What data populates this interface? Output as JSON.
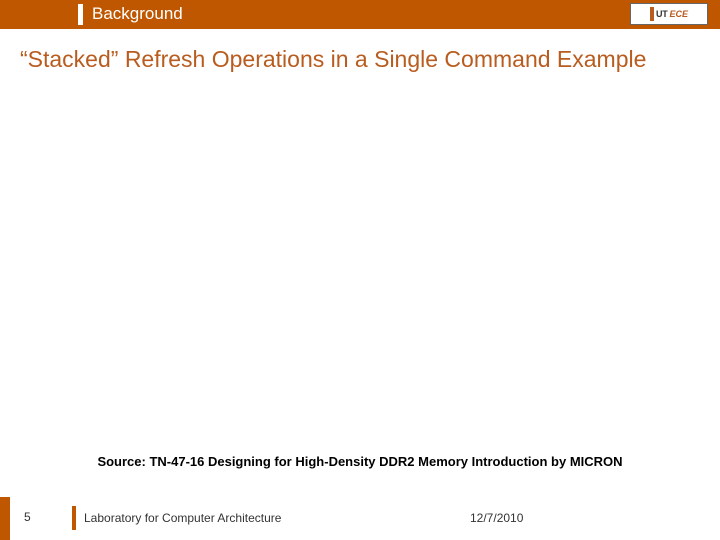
{
  "header": {
    "section": "Background",
    "logo": {
      "line1": "UT",
      "line2": "ECE"
    }
  },
  "title": "“Stacked” Refresh Operations in a Single Command Example",
  "source": "Source: TN-47-16 Designing for High-Density DDR2 Memory Introduction by MICRON",
  "footer": {
    "page": "5",
    "lab": "Laboratory for Computer Architecture",
    "date": "12/7/2010"
  }
}
